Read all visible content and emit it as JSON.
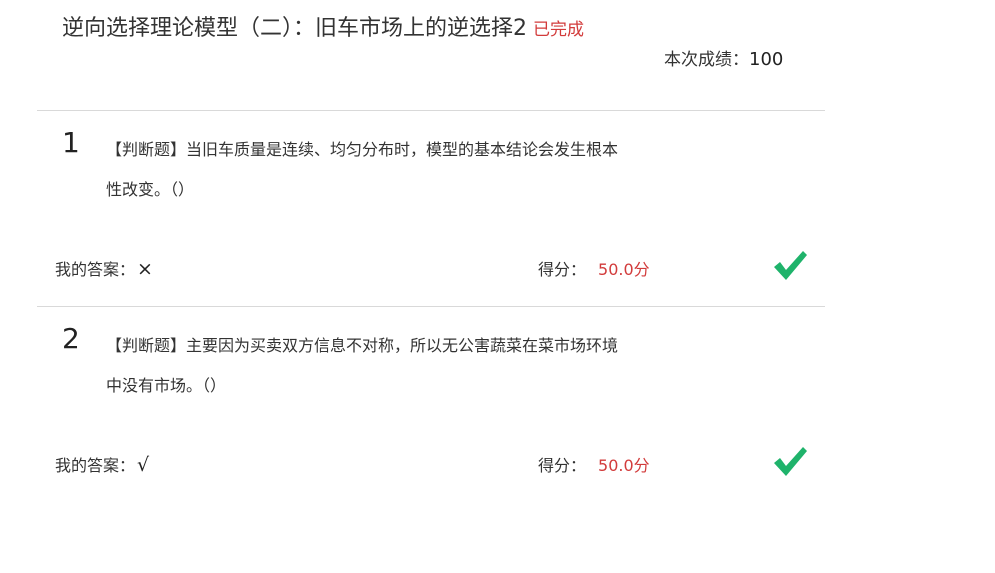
{
  "header": {
    "title": "逆向选择理论模型（二）：旧车市场上的逆选择2",
    "status": "已完成",
    "score_label": "本次成绩：",
    "score_value": "100"
  },
  "questions": [
    {
      "number": "1",
      "text": "【判断题】当旧车质量是连续、均匀分布时，模型的基本结论会发生根本性改变。（）",
      "answer_label": "我的答案：",
      "answer_value": "×",
      "score_label": "得分：",
      "score_value": "50.0分",
      "result_icon": "check-icon"
    },
    {
      "number": "2",
      "text": "【判断题】主要因为买卖双方信息不对称，所以无公害蔬菜在菜市场环境中没有市场。（）",
      "answer_label": "我的答案：",
      "answer_value": "√",
      "score_label": "得分：",
      "score_value": "50.0分",
      "result_icon": "check-icon"
    }
  ],
  "colors": {
    "status": "#d23b3b",
    "score": "#d23b3b",
    "check": "#1fb36b",
    "divider": "#d9d9d9"
  }
}
